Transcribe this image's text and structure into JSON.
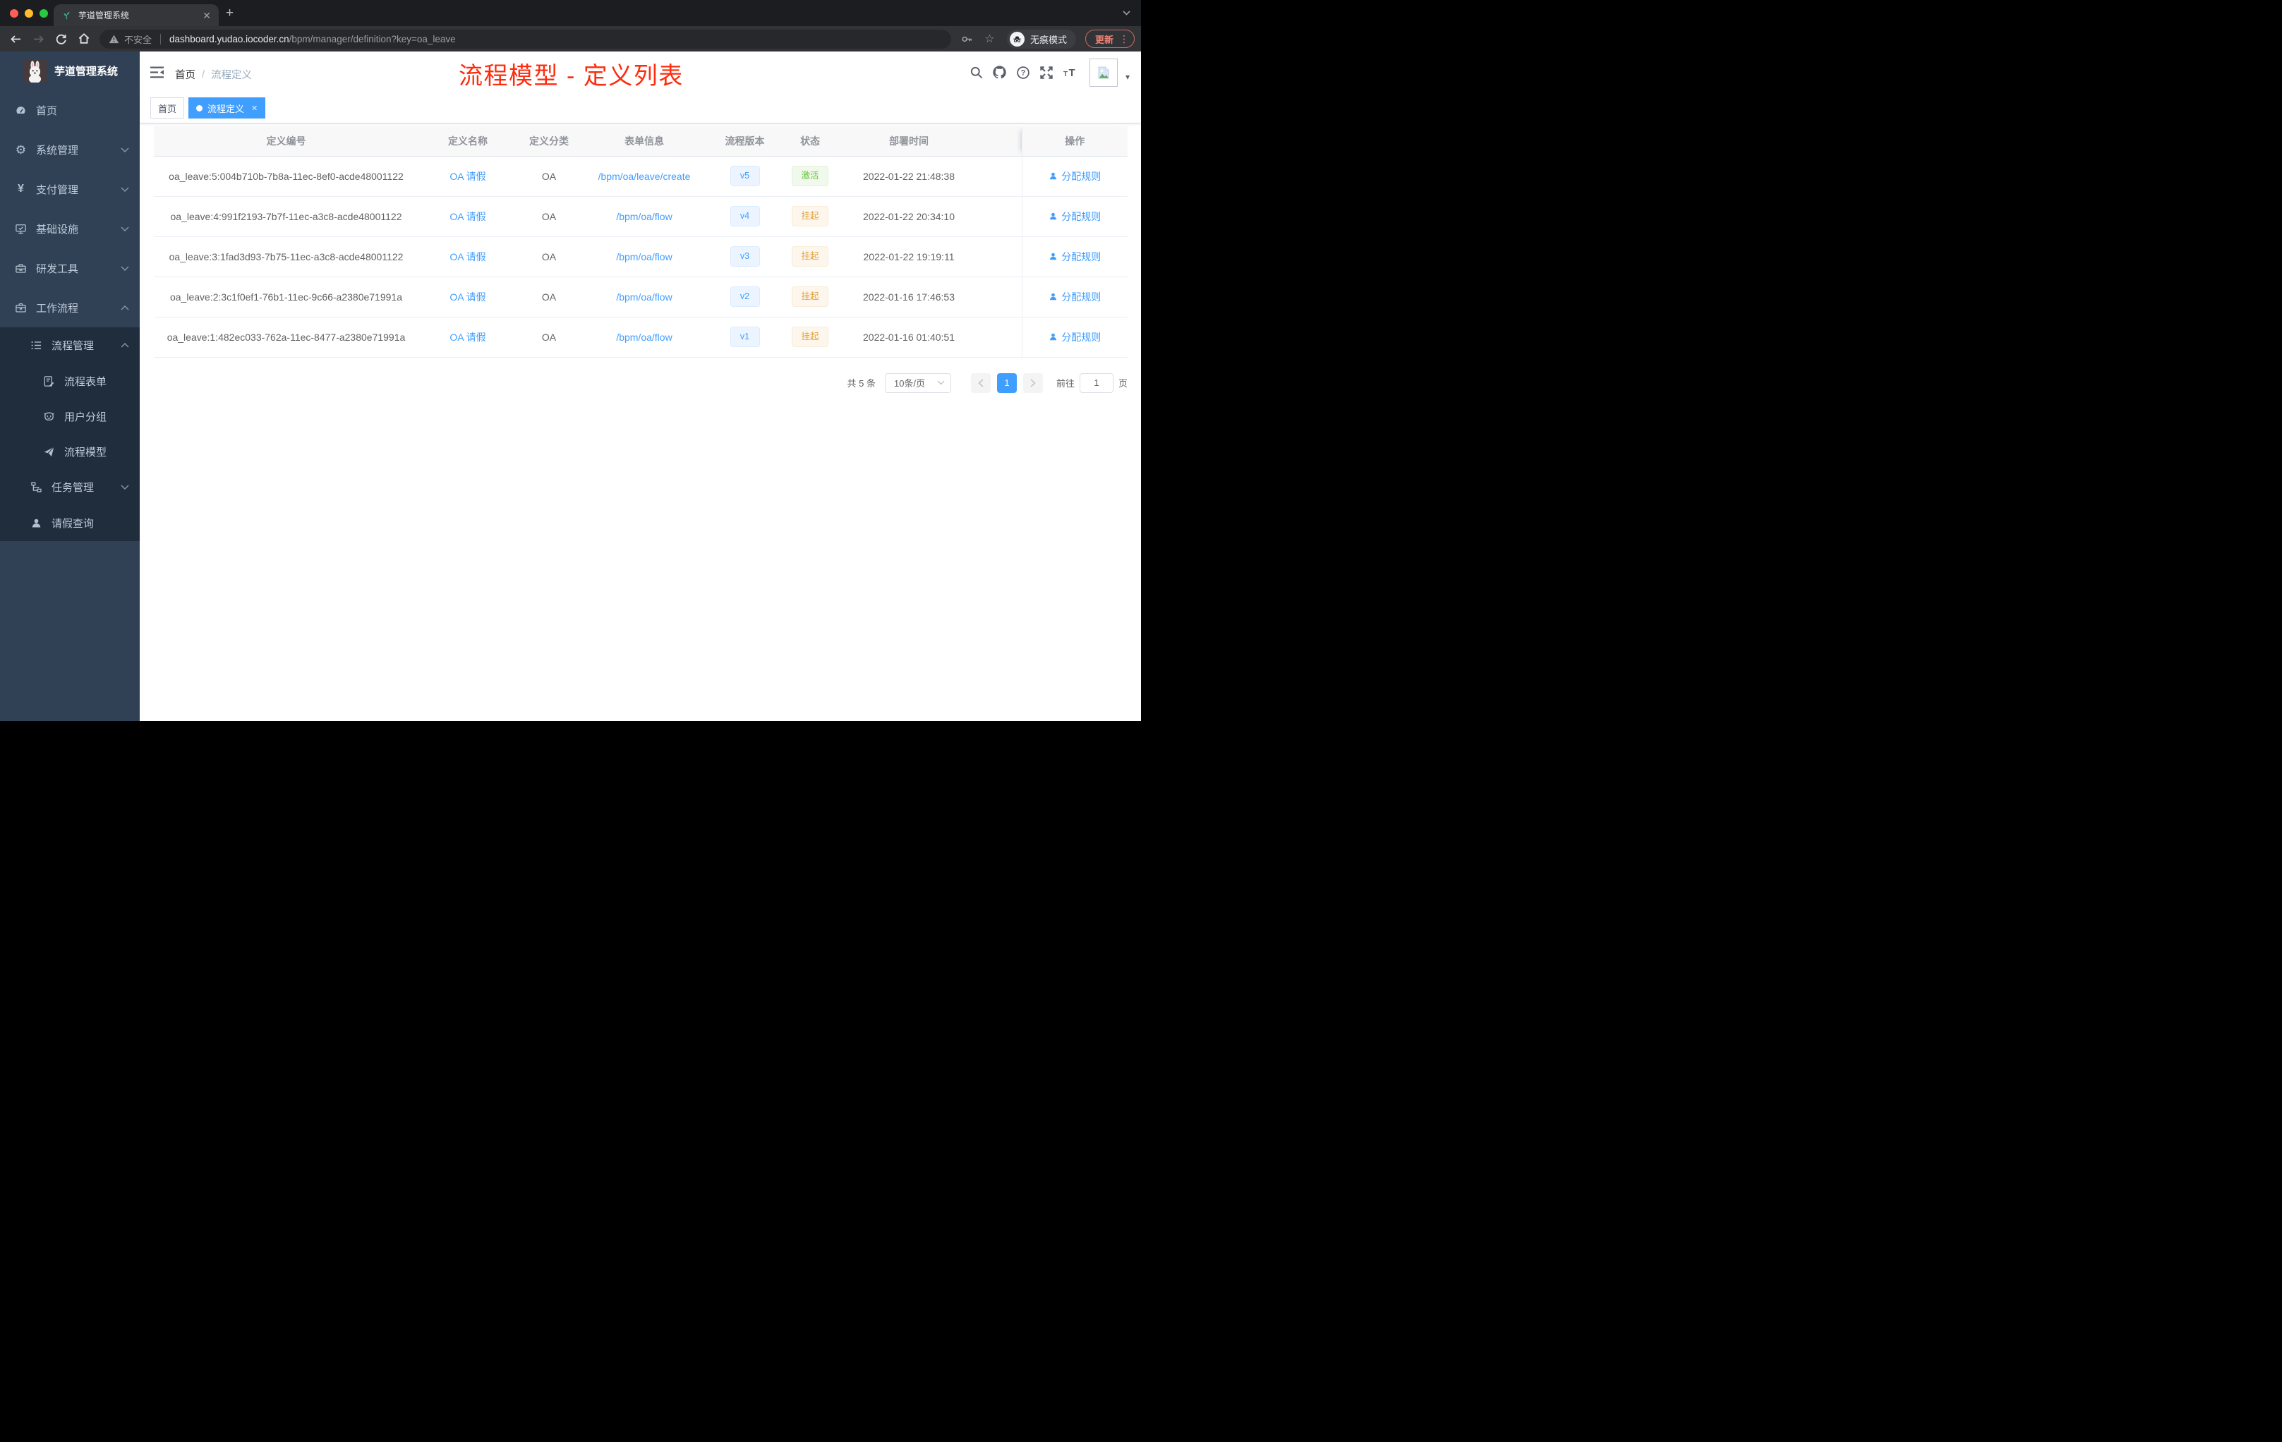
{
  "browser": {
    "tab_title": "芋道管理系统",
    "security_label": "不安全",
    "url_host": "dashboard.yudao.iocoder.cn",
    "url_path": "/bpm/manager/definition?key=oa_leave",
    "incognito_label": "无痕模式",
    "update_label": "更新"
  },
  "sidebar": {
    "logo_title": "芋道管理系统",
    "items": [
      {
        "label": "首页",
        "icon": "dashboard-icon",
        "level": 1
      },
      {
        "label": "系统管理",
        "icon": "gear-icon",
        "level": 1,
        "expand": "down"
      },
      {
        "label": "支付管理",
        "icon": "yen-icon",
        "level": 1,
        "expand": "down"
      },
      {
        "label": "基础设施",
        "icon": "monitor-icon",
        "level": 1,
        "expand": "down"
      },
      {
        "label": "研发工具",
        "icon": "toolbox-icon",
        "level": 1,
        "expand": "down"
      },
      {
        "label": "工作流程",
        "icon": "briefcase-icon",
        "level": 1,
        "expand": "up"
      },
      {
        "label": "流程管理",
        "icon": "list-icon",
        "level": 2,
        "expand": "up"
      },
      {
        "label": "流程表单",
        "icon": "form-icon",
        "level": 3
      },
      {
        "label": "用户分组",
        "icon": "robot-icon",
        "level": 3
      },
      {
        "label": "流程模型",
        "icon": "paper-plane-icon",
        "level": 3
      },
      {
        "label": "任务管理",
        "icon": "tree-icon",
        "level": 2,
        "expand": "down"
      },
      {
        "label": "请假查询",
        "icon": "user-icon",
        "level": 2
      }
    ]
  },
  "header": {
    "breadcrumb": [
      "首页",
      "流程定义"
    ],
    "breadcrumb_separator": "/",
    "annotation": "流程模型 - 定义列表",
    "icons": [
      "search-icon",
      "github-icon",
      "help-icon",
      "fullscreen-icon",
      "font-size-icon",
      "avatar",
      "caret-down-icon"
    ]
  },
  "tags": [
    {
      "label": "首页",
      "active": false
    },
    {
      "label": "流程定义",
      "active": true
    }
  ],
  "table": {
    "columns": [
      "定义编号",
      "定义名称",
      "定义分类",
      "表单信息",
      "流程版本",
      "状态",
      "部署时间",
      "操作"
    ],
    "rows": [
      {
        "id": "oa_leave:5:004b710b-7b8a-11ec-8ef0-acde48001122",
        "name": "OA 请假",
        "category": "OA",
        "form": "/bpm/oa/leave/create",
        "version": "v5",
        "status": "激活",
        "status_type": "success",
        "deploy_time": "2022-01-22 21:48:38",
        "action": "分配规则"
      },
      {
        "id": "oa_leave:4:991f2193-7b7f-11ec-a3c8-acde48001122",
        "name": "OA 请假",
        "category": "OA",
        "form": "/bpm/oa/flow",
        "version": "v4",
        "status": "挂起",
        "status_type": "warning",
        "deploy_time": "2022-01-22 20:34:10",
        "action": "分配规则"
      },
      {
        "id": "oa_leave:3:1fad3d93-7b75-11ec-a3c8-acde48001122",
        "name": "OA 请假",
        "category": "OA",
        "form": "/bpm/oa/flow",
        "version": "v3",
        "status": "挂起",
        "status_type": "warning",
        "deploy_time": "2022-01-22 19:19:11",
        "action": "分配规则"
      },
      {
        "id": "oa_leave:2:3c1f0ef1-76b1-11ec-9c66-a2380e71991a",
        "name": "OA 请假",
        "category": "OA",
        "form": "/bpm/oa/flow",
        "version": "v2",
        "status": "挂起",
        "status_type": "warning",
        "deploy_time": "2022-01-16 17:46:53",
        "action": "分配规则"
      },
      {
        "id": "oa_leave:1:482ec033-762a-11ec-8477-a2380e71991a",
        "name": "OA 请假",
        "category": "OA",
        "form": "/bpm/oa/flow",
        "version": "v1",
        "status": "挂起",
        "status_type": "warning",
        "deploy_time": "2022-01-16 01:40:51",
        "action": "分配规则"
      }
    ]
  },
  "pagination": {
    "total": "共 5 条",
    "page_size": "10条/页",
    "page": "1",
    "goto_label": "前往",
    "goto_value": "1",
    "unit_label": "页"
  },
  "colors": {
    "accent": "#409eff",
    "annotation_red": "#fe2c0e",
    "sidebar_bg": "#304156",
    "submenu_bg": "#1f2d3d",
    "status_active_green": "#67c23a",
    "status_suspended_orange": "#e6a23c",
    "tag_active_blue": "#409eff"
  }
}
